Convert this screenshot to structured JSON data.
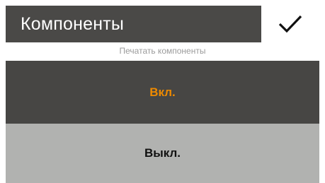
{
  "header": {
    "title": "Компоненты",
    "confirm_icon": "checkmark-icon"
  },
  "subtitle": "Печатать компоненты",
  "options": [
    {
      "label": "Вкл.",
      "selected": true
    },
    {
      "label": "Выкл.",
      "selected": false
    }
  ],
  "colors": {
    "header_bg": "#4a4947",
    "selected_bg": "#474644",
    "selected_text": "#ee8a00",
    "unselected_bg": "#b1b2b0",
    "unselected_text": "#111111"
  }
}
